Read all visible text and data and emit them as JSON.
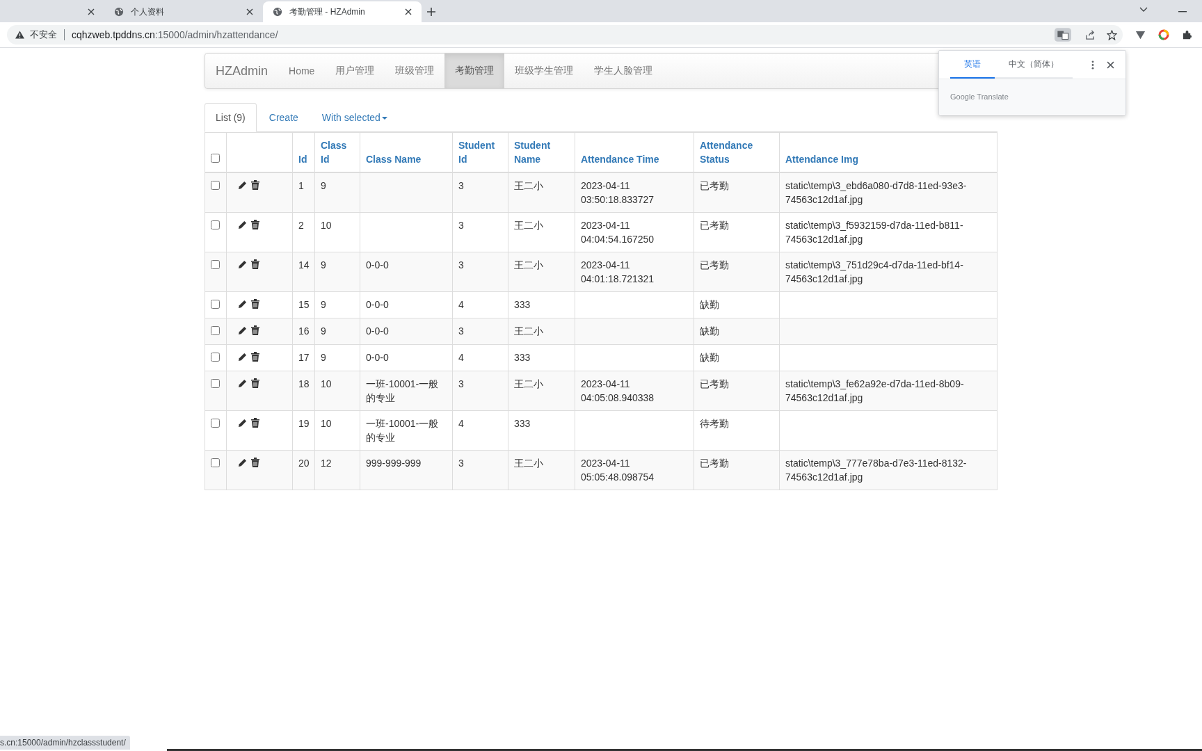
{
  "browser": {
    "tabs": [
      {
        "selected": false
      },
      {
        "title": "个人资料",
        "selected": false
      },
      {
        "title": "考勤管理 - HZAdmin",
        "selected": true
      }
    ],
    "security_label": "不安全",
    "url_host": "cqhzweb.tpddns.cn",
    "url_path": ":15000/admin/hzattendance/",
    "status_url": "s.cn:15000/admin/hzclassstudent/"
  },
  "navbar": {
    "brand": "HZAdmin",
    "items": [
      {
        "label": "Home",
        "selected": false
      },
      {
        "label": "用户管理",
        "selected": false
      },
      {
        "label": "班级管理",
        "selected": false
      },
      {
        "label": "考勤管理",
        "selected": true
      },
      {
        "label": "班级学生管理",
        "selected": false
      },
      {
        "label": "学生人脸管理",
        "selected": false
      }
    ]
  },
  "tabs": [
    {
      "label": "List (9)",
      "selected": true,
      "kind": "link"
    },
    {
      "label": "Create",
      "selected": false,
      "kind": "link"
    },
    {
      "label": "With selected",
      "selected": false,
      "kind": "dropdown"
    }
  ],
  "table": {
    "select_all_checked": false,
    "columns": [
      "Id",
      "Class Id",
      "Class Name",
      "Student Id",
      "Student Name",
      "Attendance Time",
      "Attendance Status",
      "Attendance Img"
    ],
    "rows": [
      {
        "checked": false,
        "cells": [
          "1",
          "9",
          "",
          "3",
          "王二小",
          "2023-04-11 03:50:18.833727",
          "已考勤",
          "static\\temp\\3_ebd6a080-d7d8-11ed-93e3-74563c12d1af.jpg"
        ]
      },
      {
        "checked": false,
        "cells": [
          "2",
          "10",
          "",
          "3",
          "王二小",
          "2023-04-11 04:04:54.167250",
          "已考勤",
          "static\\temp\\3_f5932159-d7da-11ed-b811-74563c12d1af.jpg"
        ]
      },
      {
        "checked": false,
        "cells": [
          "14",
          "9",
          "0-0-0",
          "3",
          "王二小",
          "2023-04-11 04:01:18.721321",
          "已考勤",
          "static\\temp\\3_751d29c4-d7da-11ed-bf14-74563c12d1af.jpg"
        ]
      },
      {
        "checked": false,
        "cells": [
          "15",
          "9",
          "0-0-0",
          "4",
          "333",
          "",
          "缺勤",
          ""
        ]
      },
      {
        "checked": false,
        "cells": [
          "16",
          "9",
          "0-0-0",
          "3",
          "王二小",
          "",
          "缺勤",
          ""
        ]
      },
      {
        "checked": false,
        "cells": [
          "17",
          "9",
          "0-0-0",
          "4",
          "333",
          "",
          "缺勤",
          ""
        ]
      },
      {
        "checked": false,
        "cells": [
          "18",
          "10",
          "一班-10001-一般的专业",
          "3",
          "王二小",
          "2023-04-11 04:05:08.940338",
          "已考勤",
          "static\\temp\\3_fe62a92e-d7da-11ed-8b09-74563c12d1af.jpg"
        ]
      },
      {
        "checked": false,
        "cells": [
          "19",
          "10",
          "一班-10001-一般的专业",
          "4",
          "333",
          "",
          "待考勤",
          ""
        ]
      },
      {
        "checked": false,
        "cells": [
          "20",
          "12",
          "999-999-999",
          "3",
          "王二小",
          "2023-04-11 05:05:48.098754",
          "已考勤",
          "static\\temp\\3_777e78ba-d7e3-11ed-8132-74563c12d1af.jpg"
        ]
      }
    ]
  },
  "translate_popup": {
    "languages": [
      {
        "label": "英语",
        "selected": true
      },
      {
        "label": "中文（简体）",
        "selected": false
      }
    ],
    "footer": "Google Translate"
  }
}
